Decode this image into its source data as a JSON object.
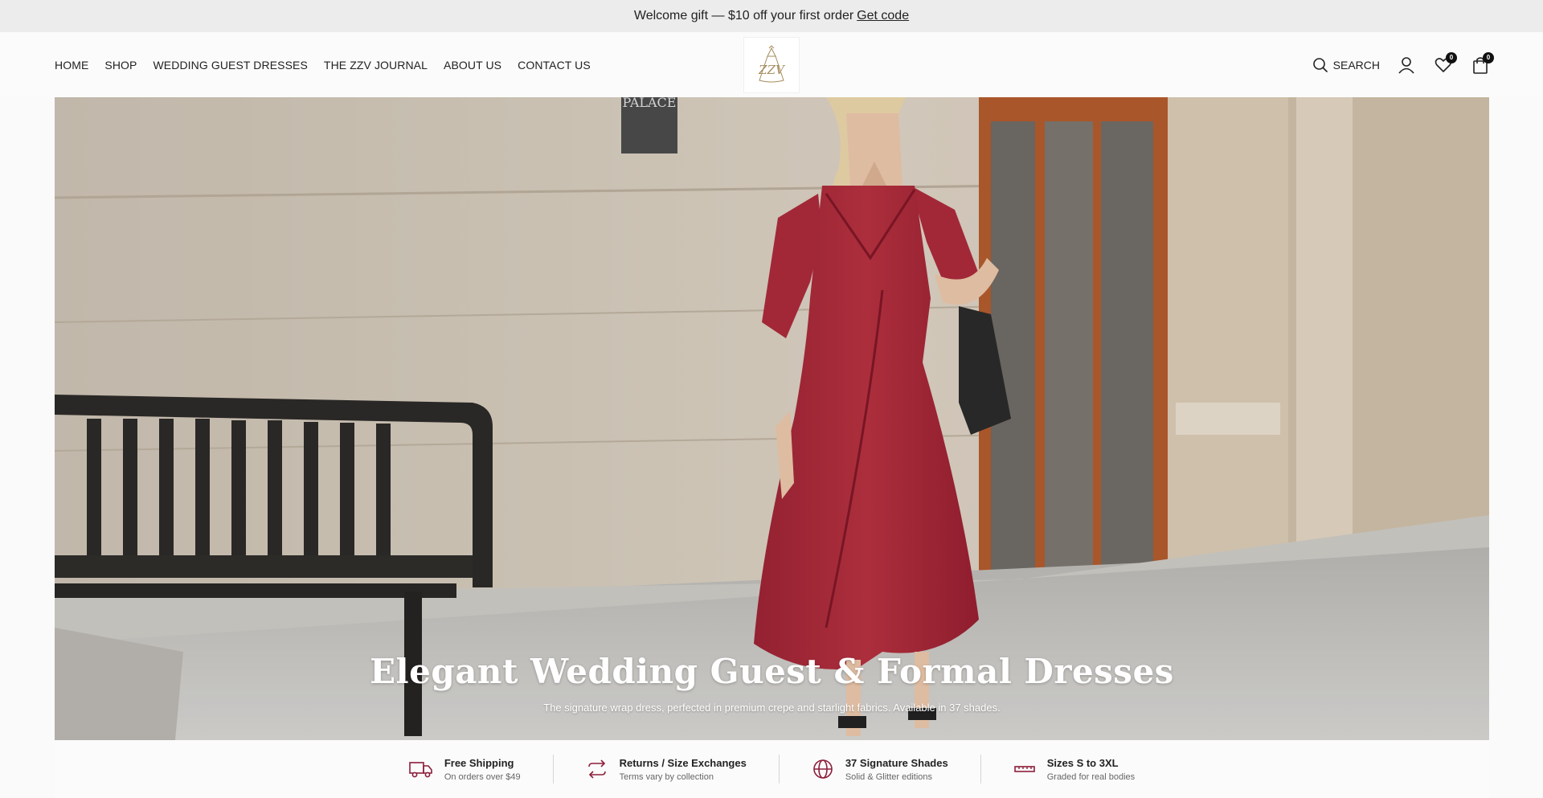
{
  "announcement": {
    "text": "Welcome gift — $10 off your first order",
    "link": "Get code"
  },
  "nav": {
    "items": [
      "HOME",
      "SHOP",
      "WEDDING GUEST DRESSES",
      "THE ZZV JOURNAL",
      "ABOUT US",
      "CONTACT US"
    ]
  },
  "logo": {
    "mark": "ZZV"
  },
  "tools": {
    "search_label": "SEARCH",
    "wishlist_count": "0",
    "cart_count": "0",
    "icons": [
      "search-icon",
      "account-icon",
      "heart-icon",
      "bag-icon"
    ]
  },
  "hero": {
    "title": "Elegant Wedding Guest & Formal Dresses",
    "subtitle": "The signature wrap dress, perfected in premium crepe and starlight fabrics. Available in 37 shades.",
    "sign_text": "PALACE"
  },
  "features": [
    {
      "icon": "truck-icon",
      "title": "Free Shipping",
      "subtitle": "On orders over $49"
    },
    {
      "icon": "exchange-icon",
      "title": "Returns / Size Exchanges",
      "subtitle": "Terms vary by collection"
    },
    {
      "icon": "globe-icon",
      "title": "37 Signature Shades",
      "subtitle": "Solid & Glitter editions"
    },
    {
      "icon": "ruler-icon",
      "title": "Sizes S to 3XL",
      "subtitle": "Graded for real bodies"
    }
  ],
  "colors": {
    "accent": "#8c1f3a",
    "dress": "#b3303f",
    "announcement_bg": "#ececec",
    "logo_gold": "#a58b5c"
  }
}
